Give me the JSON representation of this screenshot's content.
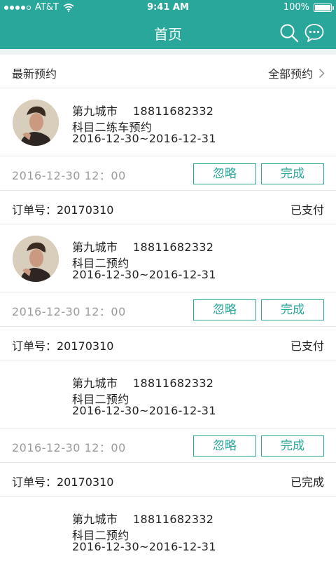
{
  "status_bar": {
    "carrier": "AT&T",
    "time": "9:41 AM",
    "battery": "100%"
  },
  "header": {
    "title": "首页"
  },
  "section": {
    "label": "最新预约",
    "link": "全部预约"
  },
  "cards": [
    {
      "has_avatar": true,
      "city": "第九城市",
      "phone": "18811682332",
      "subject": "科目二练车预约",
      "date_range": "2016-12-30~2016-12-31",
      "timestamp": "2016-12-30  12：00",
      "ignore": "忽略",
      "done": "完成",
      "order": "订单号：20170310",
      "status": "已支付"
    },
    {
      "has_avatar": true,
      "city": "第九城市",
      "phone": "18811682332",
      "subject": "科目二预约",
      "date_range": "2016-12-30~2016-12-31",
      "timestamp": "2016-12-30  12：00",
      "ignore": "忽略",
      "done": "完成",
      "order": "订单号：20170310",
      "status": "已支付"
    },
    {
      "has_avatar": false,
      "city": "第九城市",
      "phone": "18811682332",
      "subject": "科目二预约",
      "date_range": "2016-12-30~2016-12-31",
      "timestamp": "2016-12-30  12：00",
      "ignore": "忽略",
      "done": "完成",
      "order": "订单号：20170310",
      "status": "已完成"
    },
    {
      "has_avatar": false,
      "city": "第九城市",
      "phone": "18811682332",
      "subject": "科目二预约",
      "date_range": "2016-12-30~2016-12-31"
    }
  ],
  "colors": {
    "brand": "#2aa79b",
    "divider": "#e6e6e6",
    "muted": "#9a9a9a"
  }
}
